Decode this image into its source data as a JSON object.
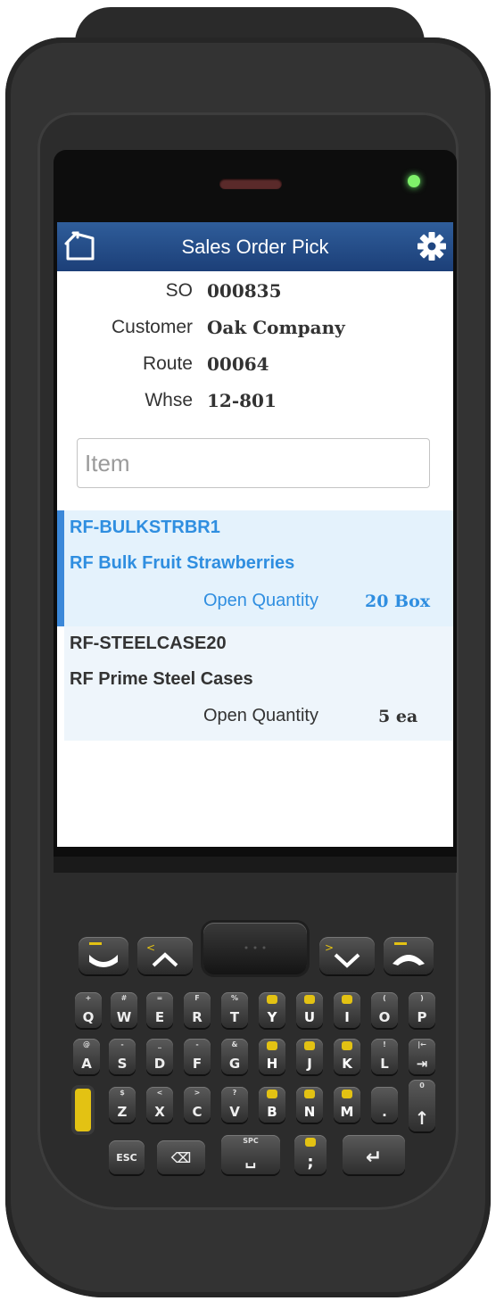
{
  "app": {
    "title": "Sales Order Pick"
  },
  "header": {
    "so_label": "SO",
    "so_value": "000835",
    "customer_label": "Customer",
    "customer_value": "Oak Company",
    "route_label": "Route",
    "route_value": "00064",
    "whse_label": "Whse",
    "whse_value": "12-801"
  },
  "item_input": {
    "placeholder": "Item",
    "value": ""
  },
  "lines": [
    {
      "code": "RF-BULKSTRBR1",
      "description": "RF Bulk Fruit Strawberries",
      "qty_label": "Open Quantity",
      "qty_value": "20 Box",
      "selected": true
    },
    {
      "code": "RF-STEELCASE20",
      "description": "RF Prime Steel Cases",
      "qty_label": "Open Quantity",
      "qty_value": "5 ea",
      "selected": false
    }
  ],
  "keypad": {
    "row1": [
      {
        "main": "Q",
        "sub": "+"
      },
      {
        "main": "W",
        "sub": "#"
      },
      {
        "main": "E",
        "sub": "="
      },
      {
        "main": "R",
        "sub": "F"
      },
      {
        "main": "T",
        "sub": "%"
      },
      {
        "main": "Y",
        "sub": "1"
      },
      {
        "main": "U",
        "sub": "2"
      },
      {
        "main": "I",
        "sub": "3"
      },
      {
        "main": "O",
        "sub": "("
      },
      {
        "main": "P",
        "sub": ")"
      }
    ],
    "row2": [
      {
        "main": "A",
        "sub": "@"
      },
      {
        "main": "S",
        "sub": "-"
      },
      {
        "main": "D",
        "sub": "_"
      },
      {
        "main": "F",
        "sub": "-"
      },
      {
        "main": "G",
        "sub": "&"
      },
      {
        "main": "H",
        "sub": "4"
      },
      {
        "main": "J",
        "sub": "5"
      },
      {
        "main": "K",
        "sub": "6"
      },
      {
        "main": "L",
        "sub": "!"
      },
      {
        "main": "⇥",
        "sub": "|←"
      }
    ],
    "row3": [
      {
        "main": "Z",
        "sub": "$"
      },
      {
        "main": "X",
        "sub": "<"
      },
      {
        "main": "C",
        "sub": ">"
      },
      {
        "main": "V",
        "sub": "?"
      },
      {
        "main": "B",
        "sub": "7"
      },
      {
        "main": "N",
        "sub": "8"
      },
      {
        "main": "M",
        "sub": "9"
      },
      {
        "main": ".",
        "sub": ""
      },
      {
        "main": "↑",
        "sub": "0"
      }
    ],
    "row4": [
      {
        "main": "ESC",
        "sub": ""
      },
      {
        "main": "⌫",
        "sub": ""
      },
      {
        "main": "␣",
        "sub": "SPC"
      },
      {
        "main": ";",
        "sub": "0"
      },
      {
        "main": "↵",
        "sub": ""
      }
    ]
  },
  "colors": {
    "titlebar": "#1c3f78",
    "accent": "#2f8ee0",
    "selected_row": "#e4f2fc",
    "row": "#eef5fb",
    "led": "#7ff06a",
    "keypad_yellow": "#e3c213"
  },
  "icons": {
    "back": "back-icon",
    "settings": "gear-icon"
  }
}
